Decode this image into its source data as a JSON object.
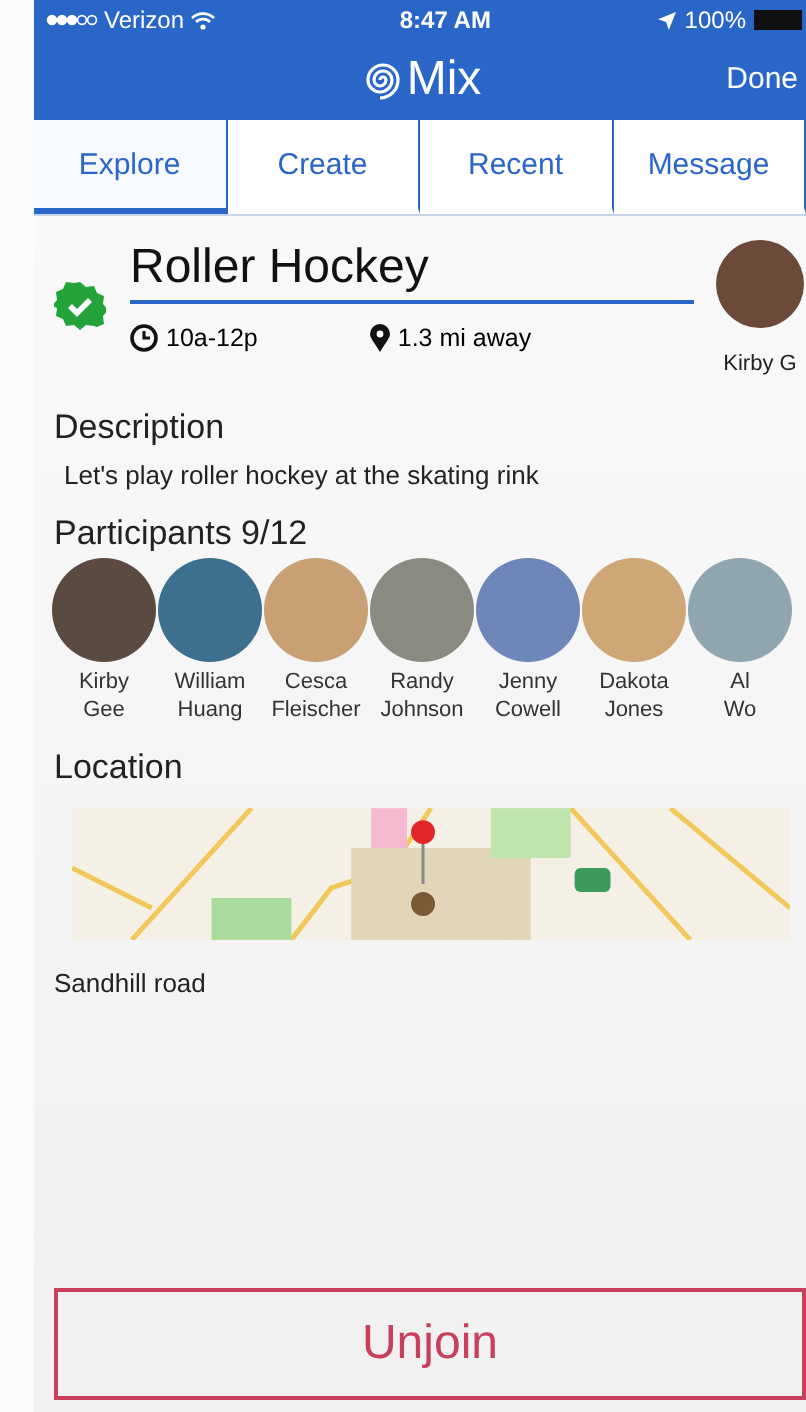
{
  "status_bar": {
    "carrier": "Verizon",
    "time": "8:47 AM",
    "battery": "100%"
  },
  "nav": {
    "title": "Mix",
    "action": "Done"
  },
  "tabs": [
    {
      "label": "Explore",
      "selected": true
    },
    {
      "label": "Create",
      "selected": false
    },
    {
      "label": "Recent",
      "selected": false
    },
    {
      "label": "Message",
      "selected": false
    }
  ],
  "event": {
    "title": "Roller Hockey",
    "joined": true,
    "time": "10a-12p",
    "distance": "1.3 mi away",
    "host": "Kirby G"
  },
  "description": {
    "heading": "Description",
    "text": "Let's play roller hockey at the skating rink"
  },
  "participants": {
    "heading": "Participants 9/12",
    "people": [
      {
        "first": "Kirby",
        "last": "Gee"
      },
      {
        "first": "William",
        "last": "Huang"
      },
      {
        "first": "Cesca",
        "last": "Fleischer"
      },
      {
        "first": "Randy",
        "last": "Johnson"
      },
      {
        "first": "Jenny",
        "last": "Cowell"
      },
      {
        "first": "Dakota",
        "last": "Jones"
      },
      {
        "first": "Al",
        "last": "Wo"
      }
    ]
  },
  "location": {
    "heading": "Location",
    "address": "Sandhill road"
  },
  "unjoin_button": "Unjoin"
}
